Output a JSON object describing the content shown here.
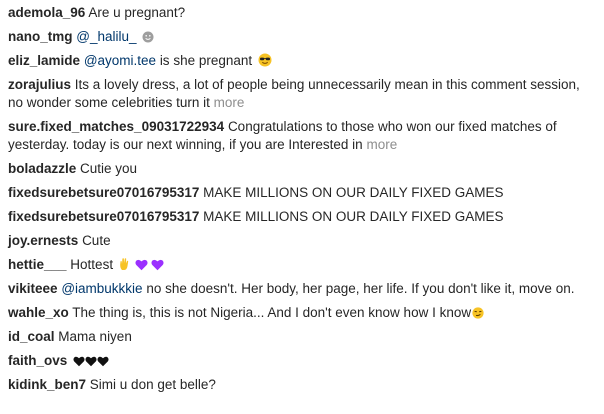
{
  "comments": [
    {
      "user": "ademola_96",
      "text": "Are u pregnant?"
    },
    {
      "user": "nano_tmg",
      "mention": "@_halilu_",
      "icons": [
        "grey-smiley-emoji"
      ]
    },
    {
      "user": "eliz_lamide",
      "mention": "@ayomi.tee",
      "text": "is she pregnant",
      "icons": [
        "sunglasses-emoji"
      ]
    },
    {
      "user": "zorajulius",
      "text": "Its a lovely dress, a lot of people being unnecessarily mean in this comment session, no wonder some celebrities turn it",
      "more": "more"
    },
    {
      "user": "sure.fixed_matches_09031722934",
      "text": "Congratulations to those who won our fixed matches of yesterday. today is our next winning, if you are Interested in",
      "more": "more"
    },
    {
      "user": "boladazzle",
      "text": "Cutie you"
    },
    {
      "user": "fixedsurebetsure07016795317",
      "text": "MAKE MILLIONS ON OUR DAILY FIXED GAMES"
    },
    {
      "user": "fixedsurebetsure07016795317",
      "text": "MAKE MILLIONS ON OUR DAILY FIXED GAMES"
    },
    {
      "user": "joy.ernests",
      "text": "Cute"
    },
    {
      "user": "hettie___",
      "text": "Hottest",
      "icons": [
        "hand-emoji",
        "purple-heart-emoji",
        "purple-heart-emoji"
      ]
    },
    {
      "user": "vikiteee",
      "mention": "@iambukkkie",
      "text": "no she doesn't. Her body, her page, her life. If you don't like it, move on."
    },
    {
      "user": "wahle_xo",
      "text": "The thing is, this is not Nigeria... And I don't even know how I know",
      "icons": [
        "smirk-emoji"
      ]
    },
    {
      "user": "id_coal",
      "text": "Mama niyen"
    },
    {
      "user": "faith_ovs",
      "icons": [
        "black-heart-emoji",
        "black-heart-emoji",
        "black-heart-emoji"
      ]
    },
    {
      "user": "kidink_ben7",
      "text": "Simi u don get belle?"
    }
  ],
  "colors": {
    "text": "#262626",
    "mention": "#00376b",
    "muted": "#8e8e8e",
    "purple": "#9b30ff",
    "emoji_yellow": "#f7c325"
  }
}
